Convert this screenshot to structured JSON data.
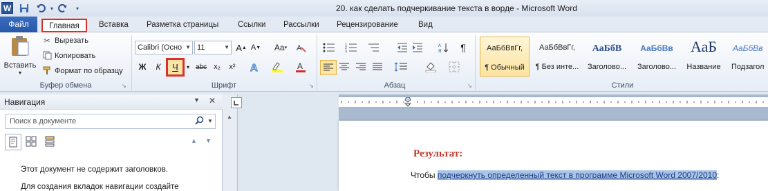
{
  "window": {
    "title": "20. как сделать подчеркивание текста в ворде  -  Microsoft Word"
  },
  "quick_access": {
    "logo": "W",
    "items": [
      "save-icon",
      "undo-icon",
      "redo-icon"
    ]
  },
  "tabs": [
    "Файл",
    "Главная",
    "Вставка",
    "Разметка страницы",
    "Ссылки",
    "Рассылки",
    "Рецензирование",
    "Вид"
  ],
  "clipboard": {
    "paste": "Вставить",
    "cut": "Вырезать",
    "copy": "Копировать",
    "format_painter": "Формат по образцу",
    "label": "Буфер обмена"
  },
  "font": {
    "name": "Calibri (Осно",
    "size": "11",
    "bold": "Ж",
    "italic": "К",
    "underline": "Ч",
    "strike": "abc",
    "subscript": "x₂",
    "superscript": "x²",
    "grow": "A",
    "shrink": "A",
    "case": "Aa",
    "label": "Шрифт"
  },
  "paragraph": {
    "label": "Абзац"
  },
  "styles": {
    "label": "Стили",
    "items": [
      {
        "sample": "АаБбВвГг,",
        "name": "¶ Обычный"
      },
      {
        "sample": "АаБбВвГг,",
        "name": "¶ Без инте..."
      },
      {
        "sample": "АаБбВ",
        "name": "Заголово..."
      },
      {
        "sample": "АаБбВв",
        "name": "Заголово..."
      },
      {
        "sample": "АаБ",
        "name": "Название"
      },
      {
        "sample": "АаБбВв",
        "name": "Подзагол"
      }
    ]
  },
  "navigation": {
    "title": "Навигация",
    "search_placeholder": "Поиск в документе",
    "empty_line1": "Этот документ не содержит заголовков.",
    "empty_line2": "Для создания вкладок навигации создайте"
  },
  "document": {
    "heading": "Результат:",
    "text_before": "Чтобы ",
    "text_highlight": "подчеркнуть определенный текст в программе Microsoft Word 2007/2010",
    "text_after": ":"
  },
  "colors": {
    "accent": "#2b579a",
    "annotation": "#d9322b",
    "heading_red": "#c0392b"
  }
}
